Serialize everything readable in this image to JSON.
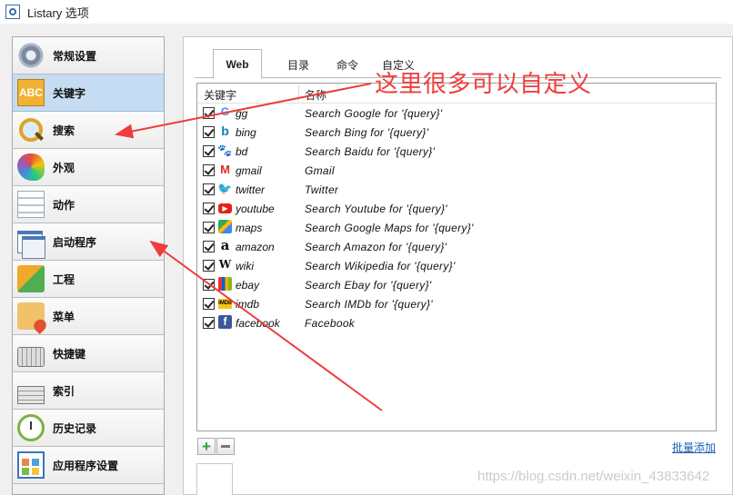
{
  "window": {
    "title": "Listary 选项"
  },
  "sidebar": {
    "items": [
      {
        "label": "常规设置",
        "icon": "gear-icon",
        "active": false
      },
      {
        "label": "关键字",
        "icon": "abc-icon",
        "active": true
      },
      {
        "label": "搜索",
        "icon": "magnifier-icon",
        "active": false
      },
      {
        "label": "外观",
        "icon": "palette-icon",
        "active": false
      },
      {
        "label": "动作",
        "icon": "action-list-icon",
        "active": false
      },
      {
        "label": "启动程序",
        "icon": "launcher-windows-icon",
        "active": false
      },
      {
        "label": "工程",
        "icon": "project-cubes-icon",
        "active": false
      },
      {
        "label": "菜单",
        "icon": "menu-heart-icon",
        "active": false
      },
      {
        "label": "快捷键",
        "icon": "keyboard-icon",
        "active": false
      },
      {
        "label": "索引",
        "icon": "index-icon",
        "active": false
      },
      {
        "label": "历史记录",
        "icon": "history-clock-icon",
        "active": false
      },
      {
        "label": "应用程序设置",
        "icon": "app-settings-icon",
        "active": false
      }
    ]
  },
  "tabs": [
    {
      "label": "Web",
      "active": true
    },
    {
      "label": "目录",
      "active": false
    },
    {
      "label": "命令",
      "active": false
    },
    {
      "label": "自定义",
      "active": false
    }
  ],
  "list": {
    "headers": {
      "keyword": "关键字",
      "name": "名称"
    },
    "rows": [
      {
        "checked": true,
        "icon": "google-icon",
        "glyph": "G",
        "keyword": "gg",
        "name": "Search Google for '{query}'"
      },
      {
        "checked": true,
        "icon": "bing-icon",
        "glyph": "b",
        "keyword": "bing",
        "name": "Search Bing for '{query}'"
      },
      {
        "checked": true,
        "icon": "baidu-paw-icon",
        "glyph": "🐾",
        "keyword": "bd",
        "name": "Search Baidu for '{query}'"
      },
      {
        "checked": true,
        "icon": "gmail-icon",
        "glyph": "M",
        "keyword": "gmail",
        "name": "Gmail"
      },
      {
        "checked": true,
        "icon": "twitter-icon",
        "glyph": "🐦",
        "keyword": "twitter",
        "name": "Twitter"
      },
      {
        "checked": true,
        "icon": "youtube-icon",
        "glyph": "▶",
        "keyword": "youtube",
        "name": "Search Youtube for '{query}'"
      },
      {
        "checked": true,
        "icon": "google-maps-icon",
        "glyph": "",
        "keyword": "maps",
        "name": "Search Google Maps for '{query}'"
      },
      {
        "checked": true,
        "icon": "amazon-icon",
        "glyph": "a",
        "keyword": "amazon",
        "name": "Search Amazon for '{query}'"
      },
      {
        "checked": true,
        "icon": "wikipedia-icon",
        "glyph": "W",
        "keyword": "wiki",
        "name": "Search Wikipedia for '{query}'"
      },
      {
        "checked": true,
        "icon": "ebay-icon",
        "glyph": "",
        "keyword": "ebay",
        "name": "Search Ebay for '{query}'"
      },
      {
        "checked": true,
        "icon": "imdb-icon",
        "glyph": "IMDb",
        "keyword": "imdb",
        "name": "Search IMDb for '{query}'"
      },
      {
        "checked": true,
        "icon": "facebook-icon",
        "glyph": "f",
        "keyword": "facebook",
        "name": "Facebook"
      }
    ]
  },
  "toolbar": {
    "add_label": "+",
    "bulk_add_label": "批量添加"
  },
  "overlay": {
    "annotation": "这里很多可以自定义",
    "watermark": "https://blog.csdn.net/weixin_43833642",
    "arrow_color": "#f03c3c"
  }
}
